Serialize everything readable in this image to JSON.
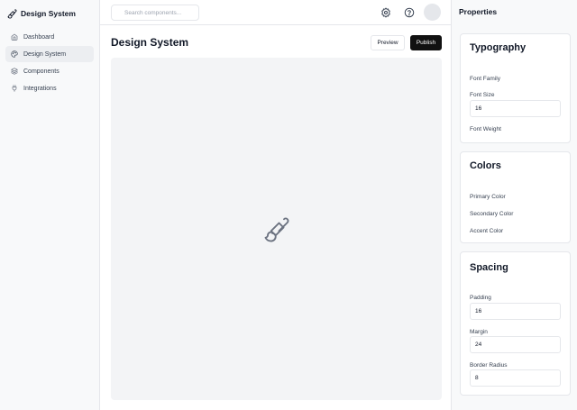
{
  "app": {
    "title": "Design System"
  },
  "sidebar": {
    "items": [
      {
        "label": "Dashboard",
        "icon": "home-icon",
        "active": false
      },
      {
        "label": "Design System",
        "icon": "palette-icon",
        "active": true
      },
      {
        "label": "Components",
        "icon": "layers-icon",
        "active": false
      },
      {
        "label": "Integrations",
        "icon": "plug-icon",
        "active": false
      }
    ]
  },
  "topbar": {
    "search_placeholder": "Search components...",
    "icons": [
      "settings-icon",
      "help-icon"
    ],
    "avatar": "user-avatar"
  },
  "main": {
    "title": "Design System",
    "preview_label": "Preview",
    "publish_label": "Publish",
    "canvas_icon": "paintbrush-icon"
  },
  "properties": {
    "title": "Properties",
    "typography": {
      "title": "Typography",
      "font_family_label": "Font Family",
      "font_size_label": "Font Size",
      "font_size_value": "16",
      "font_weight_label": "Font Weight"
    },
    "colors": {
      "title": "Colors",
      "primary_label": "Primary Color",
      "secondary_label": "Secondary Color",
      "accent_label": "Accent Color"
    },
    "spacing": {
      "title": "Spacing",
      "padding_label": "Padding",
      "padding_value": "16",
      "margin_label": "Margin",
      "margin_value": "24",
      "border_radius_label": "Border Radius",
      "border_radius_value": "8"
    }
  },
  "colors": {
    "primary_button": "#111111",
    "canvas_bg": "#f3f4f6",
    "border": "#e5e7eb"
  }
}
